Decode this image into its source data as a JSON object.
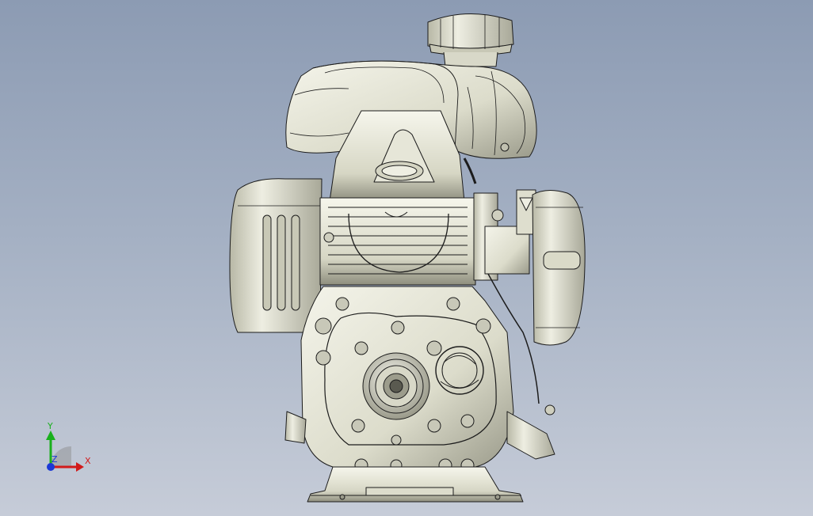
{
  "viewport": {
    "background_top": "#8c9bb3",
    "background_bottom": "#c6ccd8"
  },
  "model": {
    "shade_light": "#f2f2e6",
    "shade_mid": "#d8d8c6",
    "shade_dark": "#8c8c7c",
    "edge": "#1a1a1a"
  },
  "triad": {
    "x_label": "X",
    "y_label": "Y",
    "z_label": "Z",
    "x_color": "#d11a1a",
    "y_color": "#19b01c",
    "z_color": "#1a38d6"
  }
}
